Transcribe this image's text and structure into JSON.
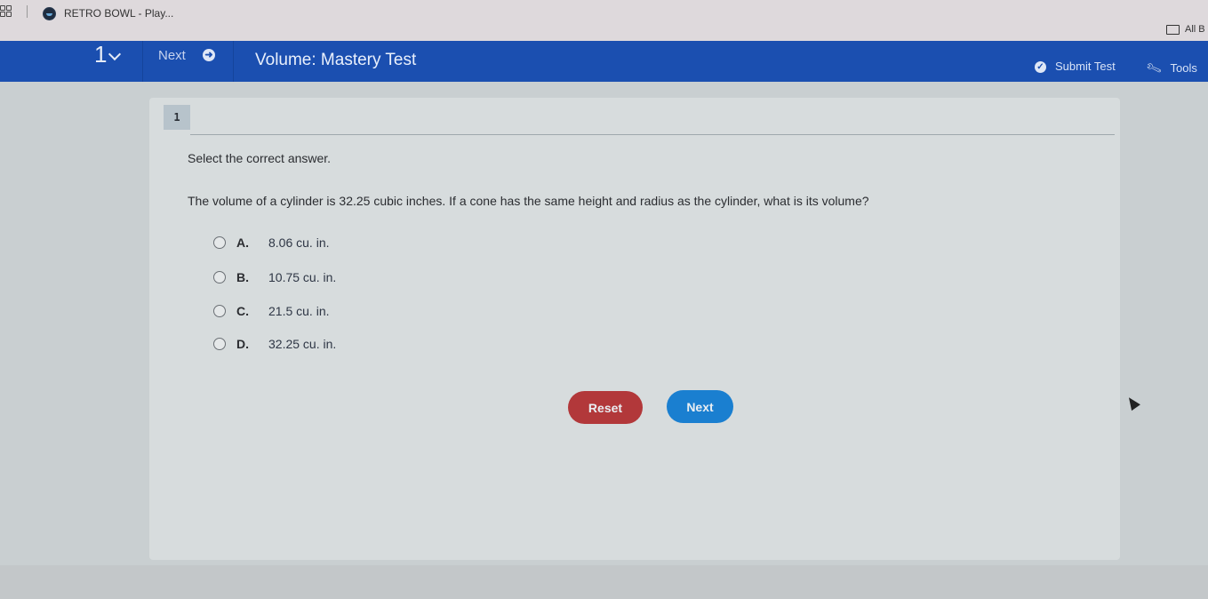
{
  "browser": {
    "tab_title": "RETRO BOWL - Play...",
    "bookmark_label": "All B"
  },
  "navbar": {
    "question_number": "1",
    "next_label": "Next",
    "test_title": "Volume: Mastery Test",
    "submit_label": "Submit Test",
    "tools_label": "Tools"
  },
  "question": {
    "badge": "1",
    "instruction": "Select the correct answer.",
    "text": "The volume of a cylinder is 32.25 cubic inches. If a cone has the same height and radius as the cylinder, what is its volume?",
    "options": [
      {
        "letter": "A.",
        "text": "8.06 cu. in."
      },
      {
        "letter": "B.",
        "text": "10.75 cu. in."
      },
      {
        "letter": "C.",
        "text": "21.5 cu. in."
      },
      {
        "letter": "D.",
        "text": "32.25 cu. in."
      }
    ]
  },
  "buttons": {
    "reset": "Reset",
    "next": "Next"
  },
  "colors": {
    "navbar": "#1b4fb0",
    "reset": "#b2383a",
    "next": "#1a7fd0"
  }
}
